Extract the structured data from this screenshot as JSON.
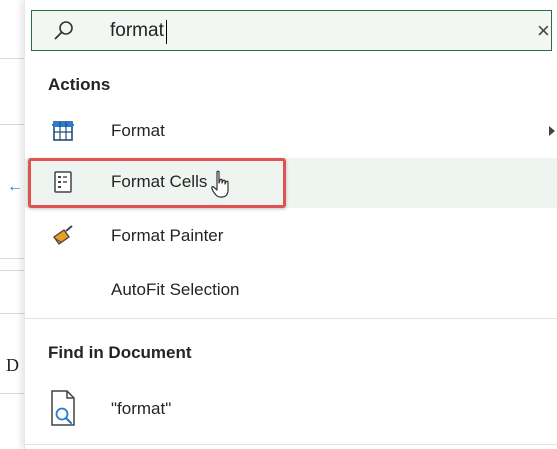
{
  "search": {
    "value": "format",
    "close_glyph": "×"
  },
  "sections": {
    "actions_title": "Actions",
    "find_title": "Find in Document"
  },
  "actions": [
    {
      "label": "Format",
      "icon": "table-format-icon",
      "has_submenu": true
    },
    {
      "label": "Format Cells",
      "icon": "format-cells-icon",
      "highlighted": true
    },
    {
      "label": "Format Painter",
      "icon": "format-painter-icon"
    },
    {
      "label": "AutoFit Selection",
      "icon": ""
    }
  ],
  "find": {
    "label": "\"format\"",
    "icon": "document-search-icon"
  },
  "background": {
    "left_arrow": "←",
    "left_letter": "D"
  },
  "colors": {
    "accent": "#2a6e44",
    "highlight_bg": "#eef5f0",
    "red_box": "#e05252",
    "icon_blue": "#2b7bd0",
    "painter_orange": "#e8a020"
  }
}
